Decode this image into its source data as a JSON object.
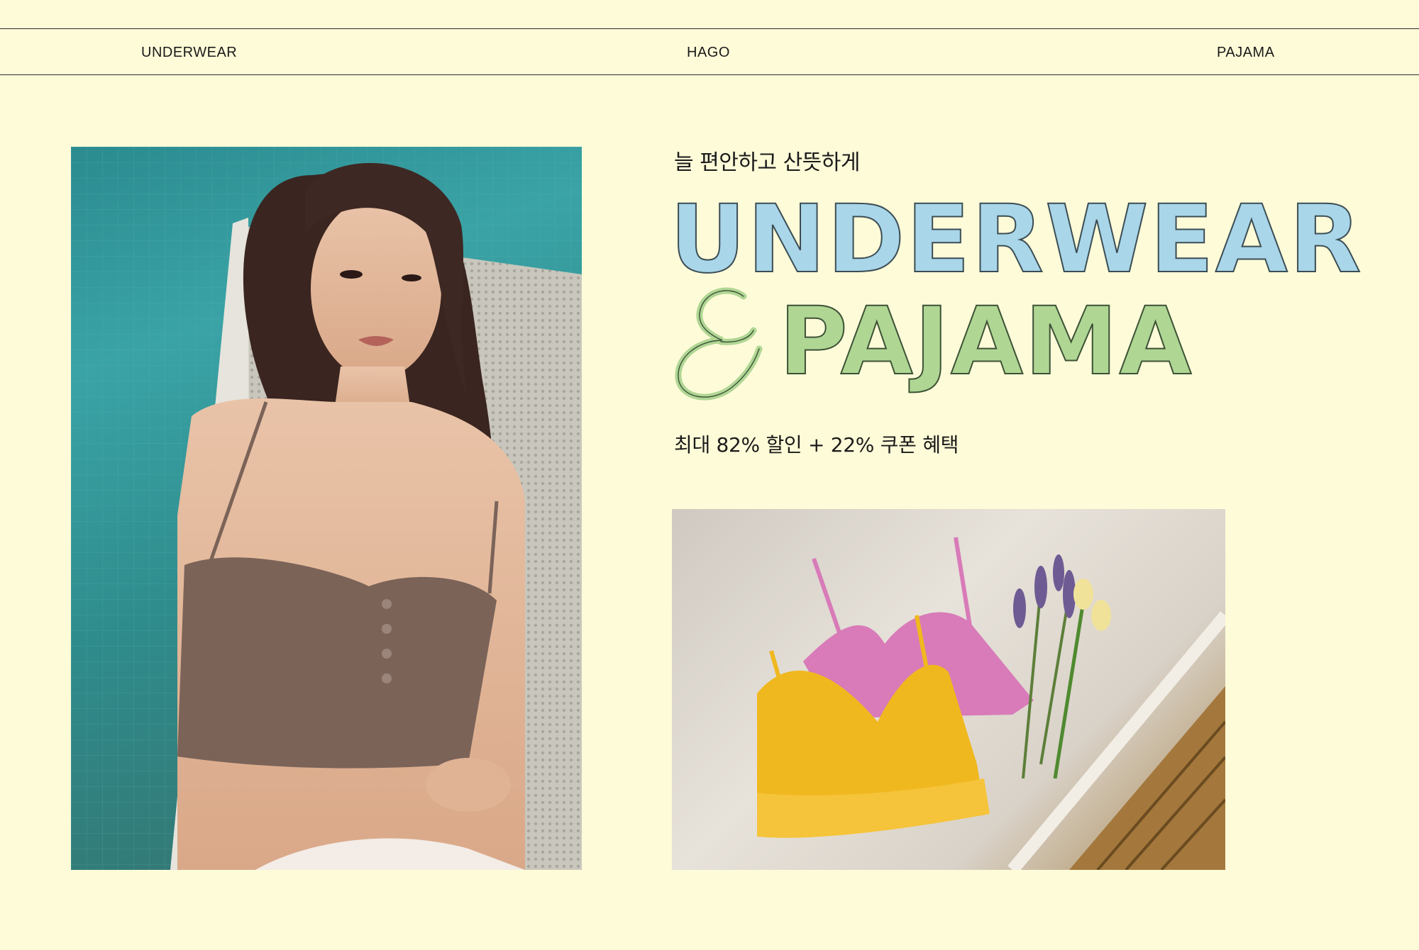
{
  "nav": {
    "left_label": "UNDERWEAR",
    "center_label": "HAGO",
    "right_label": "PAJAMA"
  },
  "hero": {
    "tagline": "늘 편안하고 산뜻하게",
    "headline_line1": "UNDERWEAR",
    "ampersand": "&",
    "headline_line2": "PAJAMA",
    "promo": "최대 82% 할인 + 22% 쿠폰 혜택"
  },
  "images": {
    "model_photo": "model-photo",
    "bras_photo": "product-photo"
  },
  "colors": {
    "background": "#fefbd8",
    "headline_blue": "#a9d6e8",
    "headline_green": "#b0d694",
    "text": "#1a1a1a"
  }
}
